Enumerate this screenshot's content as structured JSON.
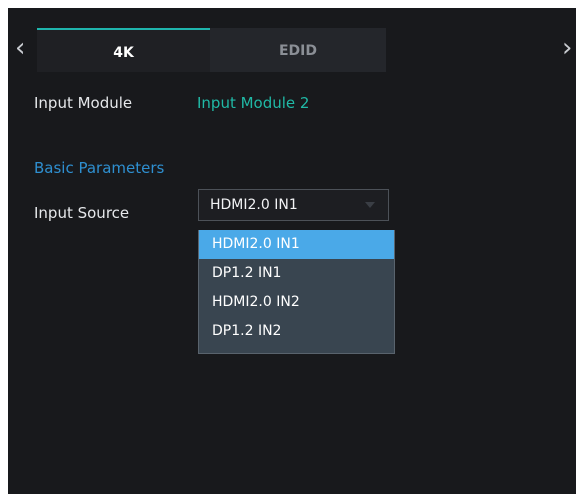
{
  "tabs": {
    "prev_arrow": "‹",
    "next_arrow": "›",
    "items": [
      {
        "label": "4K",
        "active": true
      },
      {
        "label": "EDID",
        "active": false
      }
    ]
  },
  "module": {
    "label": "Input Module",
    "value": "Input Module 2"
  },
  "basic_parameters": {
    "title": "Basic Parameters",
    "input_source": {
      "label": "Input Source",
      "selected": "HDMI2.0 IN1",
      "options": [
        "HDMI2.0 IN1",
        "DP1.2 IN1",
        "HDMI2.0 IN2",
        "DP1.2 IN2"
      ]
    }
  },
  "colors": {
    "accent_teal": "#1fb5ad",
    "section_blue": "#2e8fd0",
    "selected_option": "#4aa9e8",
    "panel_background": "#18191c"
  },
  "icons": {
    "prev": "chevron-left-icon",
    "next": "chevron-right-icon",
    "select": "caret-down-icon"
  }
}
